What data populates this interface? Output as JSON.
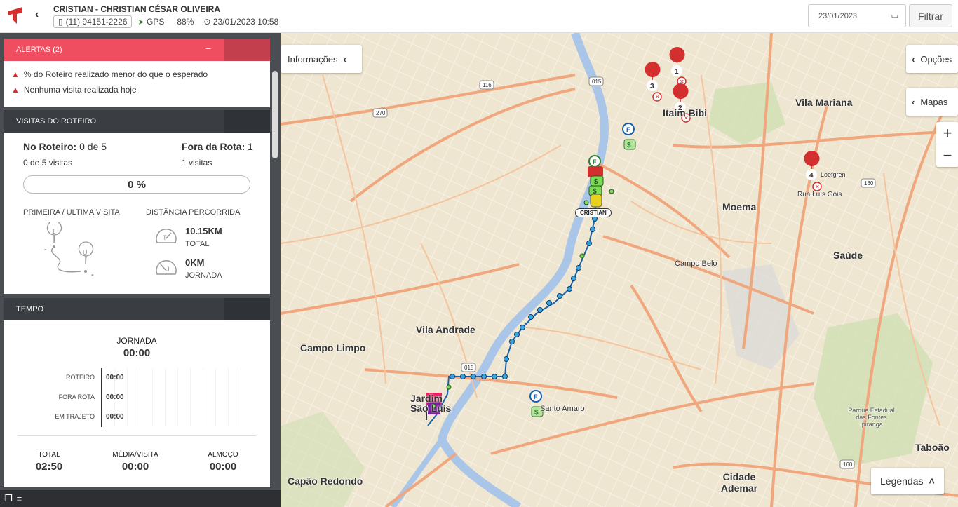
{
  "header": {
    "title": "CRISTIAN - CHRISTIAN CÉSAR OLIVEIRA",
    "phone": "(11) 94151-2226",
    "gps_label": "GPS",
    "battery": "88%",
    "timestamp": "23/01/2023 10:58",
    "date_value": "23/01/2023",
    "filter_label": "Filtrar"
  },
  "alerts": {
    "title": "ALERTAS (2)",
    "items": [
      "% do Roteiro realizado menor do que o esperado",
      "Nenhuma visita realizada hoje"
    ]
  },
  "visits": {
    "title": "VISITAS DO ROTEIRO",
    "no_roteiro_label": "No Roteiro:",
    "no_roteiro_value": "0 de 5",
    "no_roteiro_sub": "0 de 5 visitas",
    "fora_label": "Fora da Rota:",
    "fora_value": "1",
    "fora_sub": "1 visitas",
    "progress": "0 %",
    "first_last_label": "PRIMEIRA / ÚLTIMA VISITA",
    "distance_label": "DISTÂNCIA PERCORRIDA",
    "total_value": "10.15KM",
    "total_label": "TOTAL",
    "jornada_value": "0KM",
    "jornada_label": "JORNADA",
    "dash1": "-",
    "dash2": "-"
  },
  "tempo": {
    "title": "TEMPO",
    "jornada_label": "JORNADA",
    "jornada_value": "00:00",
    "rows": [
      {
        "label": "ROTEIRO",
        "value": "00:00"
      },
      {
        "label": "FORA ROTA",
        "value": "00:00"
      },
      {
        "label": "EM TRAJETO",
        "value": "00:00"
      }
    ],
    "total_label": "TOTAL",
    "total_value": "02:50",
    "media_label": "MÉDIA/VISITA",
    "media_value": "00:00",
    "almoco_label": "ALMOÇO",
    "almoco_value": "00:00"
  },
  "map": {
    "info_button": "Informações",
    "options_button": "Opções",
    "maps_button": "Mapas",
    "legend_button": "Legendas",
    "vehicle_label": "CRISTIAN",
    "places": {
      "vila_mariana": "Vila Mariana",
      "itaim_bibi": "Itaim Bibi",
      "moema": "Moema",
      "saude": "Saúde",
      "campo_belo": "Campo Belo",
      "vila_andrade": "Vila Andrade",
      "campo_limpo": "Campo Limpo",
      "jardim_sao_luis": "Jardim São Luís",
      "santo_amaro": "Santo Amaro",
      "capao_redondo": "Capão Redondo",
      "cidade_ademar": "Cidade Ademar",
      "taboao": "Taboão",
      "parque": "Parque Estadual das Fontes Ipiranga",
      "rua_luis_gois": "Rua Luís Góis",
      "loefgren": "Loefgren"
    },
    "pins": [
      "1",
      "2",
      "3",
      "4"
    ]
  }
}
